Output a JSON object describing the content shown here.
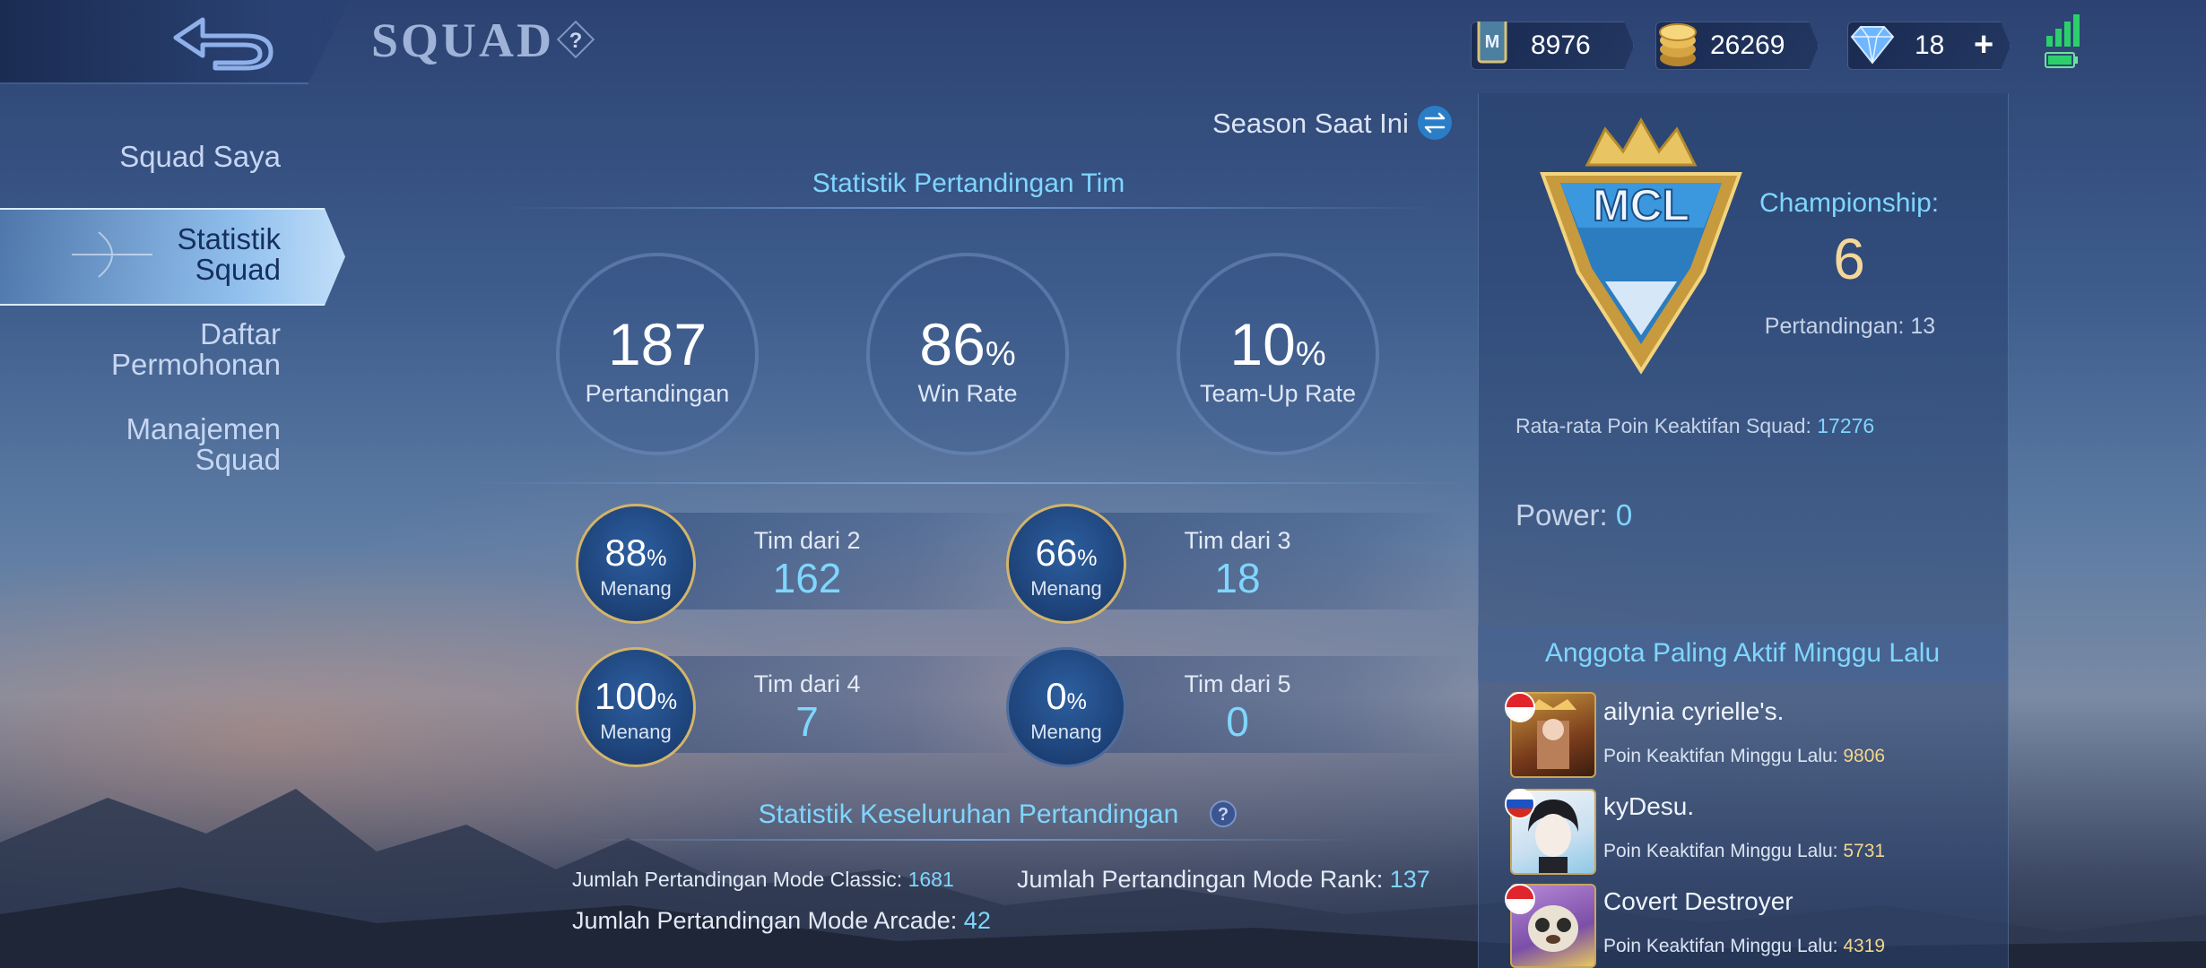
{
  "header": {
    "title": "SQUAD",
    "help": "?",
    "currencies": [
      {
        "icon": "ticket-icon",
        "value": "8976"
      },
      {
        "icon": "coins-icon",
        "value": "26269"
      },
      {
        "icon": "diamond-icon",
        "value": "18"
      }
    ],
    "add_label": "+"
  },
  "nav": {
    "items": [
      {
        "line1": "Squad Saya",
        "line2": ""
      },
      {
        "line1": "Statistik",
        "line2": "Squad"
      },
      {
        "line1": "Daftar",
        "line2": "Permohonan"
      },
      {
        "line1": "Manajemen",
        "line2": "Squad"
      }
    ]
  },
  "season": {
    "label": "Season Saat Ini"
  },
  "team_stats": {
    "title": "Statistik Pertandingan Tim",
    "matches": {
      "value": "187",
      "label": "Pertandingan"
    },
    "win_rate": {
      "value": "86",
      "unit": "%",
      "label": "Win Rate"
    },
    "teamup": {
      "value": "10",
      "unit": "%",
      "label": "Team-Up Rate"
    }
  },
  "team_sizes": [
    {
      "pct": "88",
      "unit": "%",
      "win_label": "Menang",
      "label": "Tim dari 2",
      "count": "162"
    },
    {
      "pct": "66",
      "unit": "%",
      "win_label": "Menang",
      "label": "Tim dari 3",
      "count": "18"
    },
    {
      "pct": "100",
      "unit": "%",
      "win_label": "Menang",
      "label": "Tim dari 4",
      "count": "7"
    },
    {
      "pct": "0",
      "unit": "%",
      "win_label": "Menang",
      "label": "Tim dari 5",
      "count": "0"
    }
  ],
  "overall": {
    "title": "Statistik Keseluruhan Pertandingan",
    "help": "?",
    "classic_label": "Jumlah Pertandingan Mode Classic:",
    "classic_value": "1681",
    "rank_label": "Jumlah Pertandingan Mode Rank:",
    "rank_value": "137",
    "arcade_label": "Jumlah Pertandingan Mode Arcade:",
    "arcade_value": "42"
  },
  "panel": {
    "logo_text": "MCL",
    "championship_label": "Championship:",
    "championship_value": "6",
    "matches_label": "Pertandingan: 13",
    "avg_label": "Rata-rata Poin Keaktifan Squad:",
    "avg_value": "17276",
    "power_label": "Power:",
    "power_value": "0",
    "active_title": "Anggota Paling Aktif Minggu Lalu",
    "pts_label": "Poin Keaktifan Minggu Lalu:",
    "members": [
      {
        "name": "ailynia cyrielle's.",
        "points": "9806",
        "flag": "indonesia-flag-icon"
      },
      {
        "name": "kyDesu.",
        "points": "5731",
        "flag": "russia-flag-icon"
      },
      {
        "name": "Covert Destroyer",
        "points": "4319",
        "flag": "indonesia-flag-icon"
      }
    ]
  }
}
